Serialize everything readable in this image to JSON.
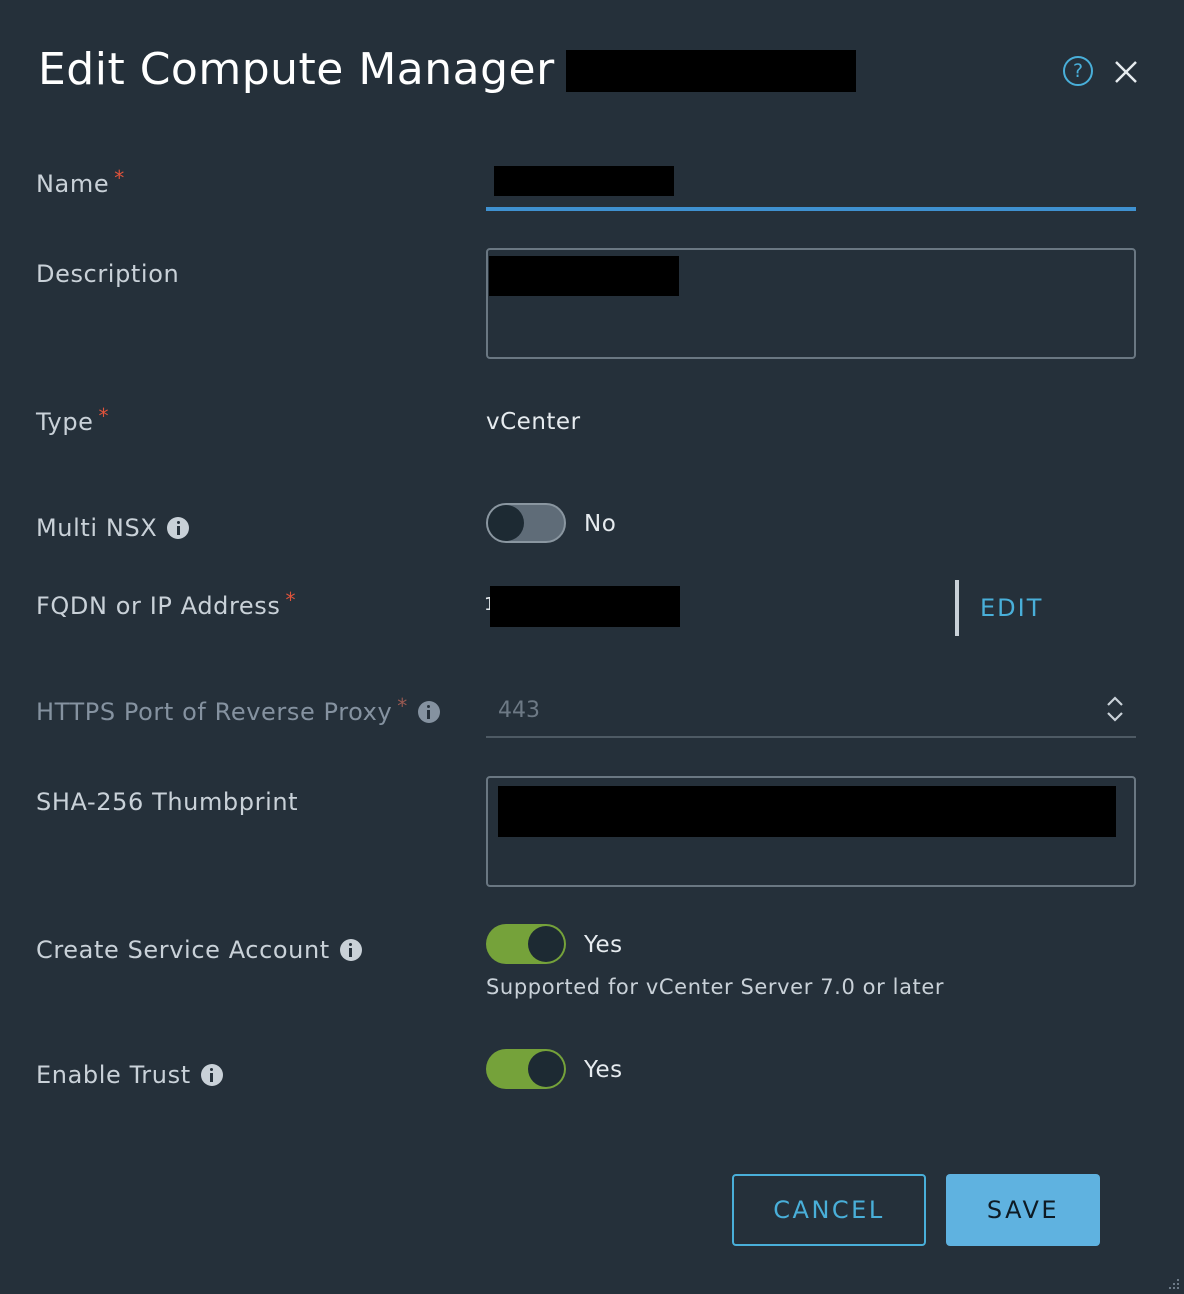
{
  "dialog": {
    "title": "Edit Compute Manager -",
    "help_icon": "help-circle-icon",
    "close_icon": "close-icon"
  },
  "fields": {
    "name": {
      "label": "Name"
    },
    "description": {
      "label": "Description"
    },
    "type": {
      "label": "Type",
      "value": "vCenter"
    },
    "multi_nsx": {
      "label": "Multi NSX",
      "state": false,
      "state_label": "No"
    },
    "fqdn": {
      "label": "FQDN or IP Address",
      "visible_prefix": "1",
      "edit_label": "EDIT"
    },
    "https_port": {
      "label": "HTTPS Port of Reverse Proxy",
      "value": "443"
    },
    "thumbprint": {
      "label": "SHA-256 Thumbprint"
    },
    "create_service_account": {
      "label": "Create Service Account",
      "state": true,
      "state_label": "Yes",
      "hint": "Supported for vCenter Server 7.0 or later"
    },
    "enable_trust": {
      "label": "Enable Trust",
      "state": true,
      "state_label": "Yes"
    }
  },
  "buttons": {
    "cancel": "CANCEL",
    "save": "SAVE"
  },
  "colors": {
    "background": "#25303a",
    "accent": "#49afd9",
    "toggle_on": "#75a23a",
    "required": "#e0533b",
    "save_button": "#5fb2e0"
  }
}
